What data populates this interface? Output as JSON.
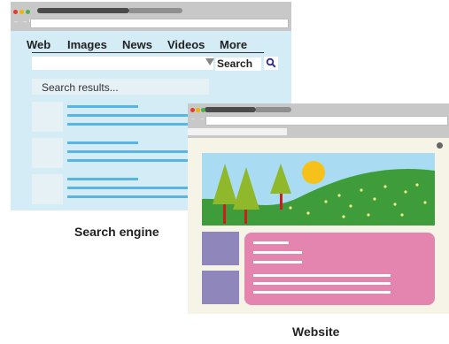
{
  "search_engine": {
    "nav": [
      "Web",
      "Images",
      "News",
      "Videos",
      "More"
    ],
    "search_button_label": "Search",
    "results_label": "Search results...",
    "caption": "Search engine"
  },
  "website": {
    "caption": "Website"
  },
  "colors": {
    "search_bg": "#d3ecf6",
    "result_line": "#5ab4e2",
    "site_bg": "#f6f4e6",
    "sidebar": "#8f86bb",
    "card": "#e485b0",
    "sky": "#a9dcf3",
    "hill": "#3f9c3a",
    "tree": "#8fb82a",
    "sun": "#f6c21a"
  },
  "icons": [
    "search-icon",
    "close-icon",
    "dropdown-arrow-icon"
  ]
}
